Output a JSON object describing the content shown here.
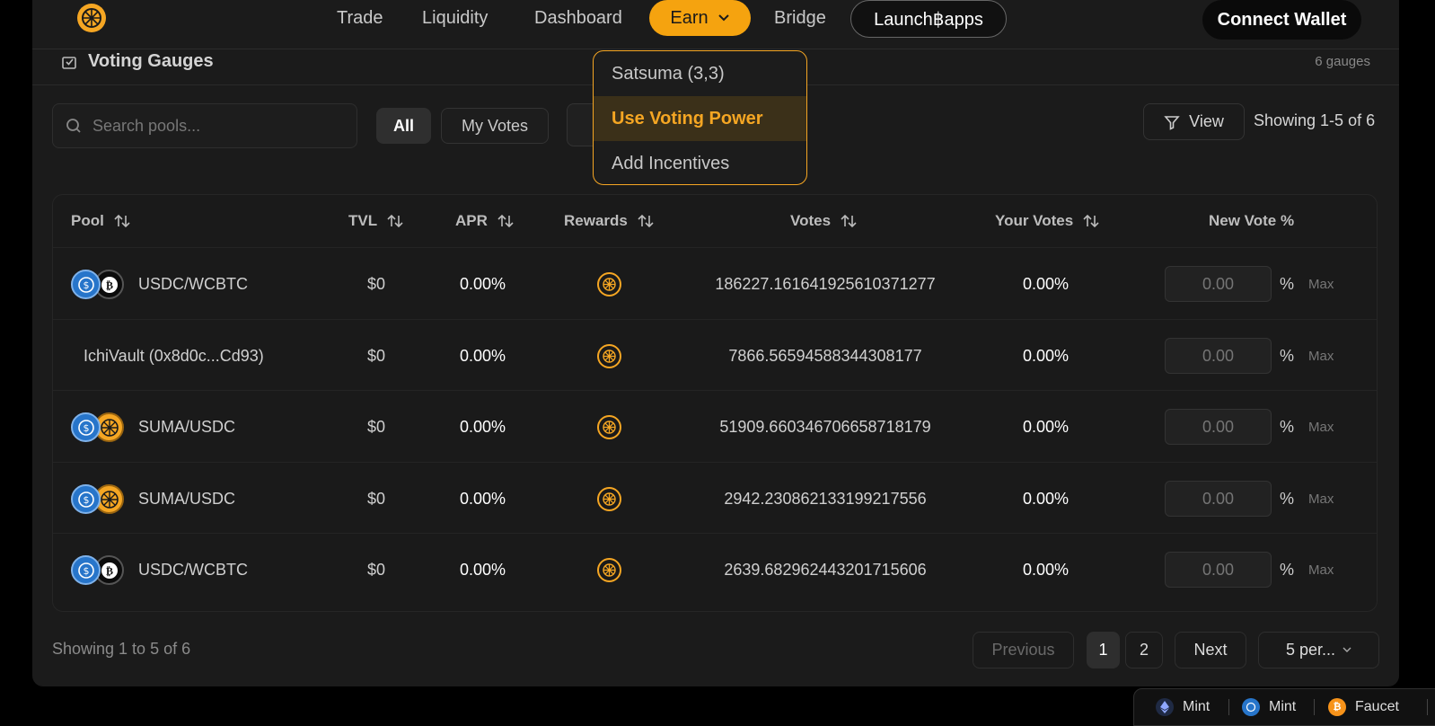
{
  "nav": {
    "links": [
      "Trade",
      "Liquidity",
      "Dashboard",
      "Bridge"
    ],
    "earn_label": "Earn",
    "launch_label": "Launch฿apps",
    "connect_label": "Connect Wallet"
  },
  "earn_menu": {
    "items": [
      "Satsuma (3,3)",
      "Use Voting Power",
      "Add Incentives"
    ],
    "active_index": 1
  },
  "section": {
    "title": "Voting Gauges",
    "count": "6 gauges"
  },
  "filters": {
    "search_placeholder": "Search pools...",
    "all_label": "All",
    "my_votes_label": "My Votes",
    "view_label": "View",
    "showing_top": "Showing 1-5 of 6"
  },
  "table": {
    "headers": {
      "pool": "Pool",
      "tvl": "TVL",
      "apr": "APR",
      "rewards": "Rewards",
      "votes": "Votes",
      "your_votes": "Your Votes",
      "new_vote": "New Vote %"
    },
    "rows": [
      {
        "pool": "USDC/WCBTC",
        "icons": [
          "usdc",
          "btc"
        ],
        "tvl": "$0",
        "apr": "0.00%",
        "votes": "186227.161641925610371277",
        "your_votes": "0.00%",
        "input_placeholder": "0.00",
        "pct": "%",
        "max": "Max"
      },
      {
        "pool": "IchiVault (0x8d0c...Cd93)",
        "icons": [],
        "tvl": "$0",
        "apr": "0.00%",
        "votes": "7866.56594588344308177",
        "your_votes": "0.00%",
        "input_placeholder": "0.00",
        "pct": "%",
        "max": "Max"
      },
      {
        "pool": "SUMA/USDC",
        "icons": [
          "usdc",
          "suma"
        ],
        "tvl": "$0",
        "apr": "0.00%",
        "votes": "51909.660346706658718179",
        "your_votes": "0.00%",
        "input_placeholder": "0.00",
        "pct": "%",
        "max": "Max"
      },
      {
        "pool": "SUMA/USDC",
        "icons": [
          "usdc",
          "suma"
        ],
        "tvl": "$0",
        "apr": "0.00%",
        "votes": "2942.230862133199217556",
        "your_votes": "0.00%",
        "input_placeholder": "0.00",
        "pct": "%",
        "max": "Max"
      },
      {
        "pool": "USDC/WCBTC",
        "icons": [
          "usdc",
          "btc"
        ],
        "tvl": "$0",
        "apr": "0.00%",
        "votes": "2639.682962443201715606",
        "your_votes": "0.00%",
        "input_placeholder": "0.00",
        "pct": "%",
        "max": "Max"
      }
    ]
  },
  "pagination": {
    "showing": "Showing 1 to 5 of 6",
    "previous": "Previous",
    "pages": [
      "1",
      "2"
    ],
    "next": "Next",
    "per_page": "5 per..."
  },
  "faucet_bar": {
    "items": [
      {
        "label": "Mint",
        "icon": "eth-icon"
      },
      {
        "label": "Mint",
        "icon": "usdc-icon"
      },
      {
        "label": "Faucet",
        "icon": "btc-icon"
      }
    ]
  },
  "colors": {
    "accent": "#f5a623",
    "background": "#1b1b1b",
    "usdc": "#2775ca"
  }
}
